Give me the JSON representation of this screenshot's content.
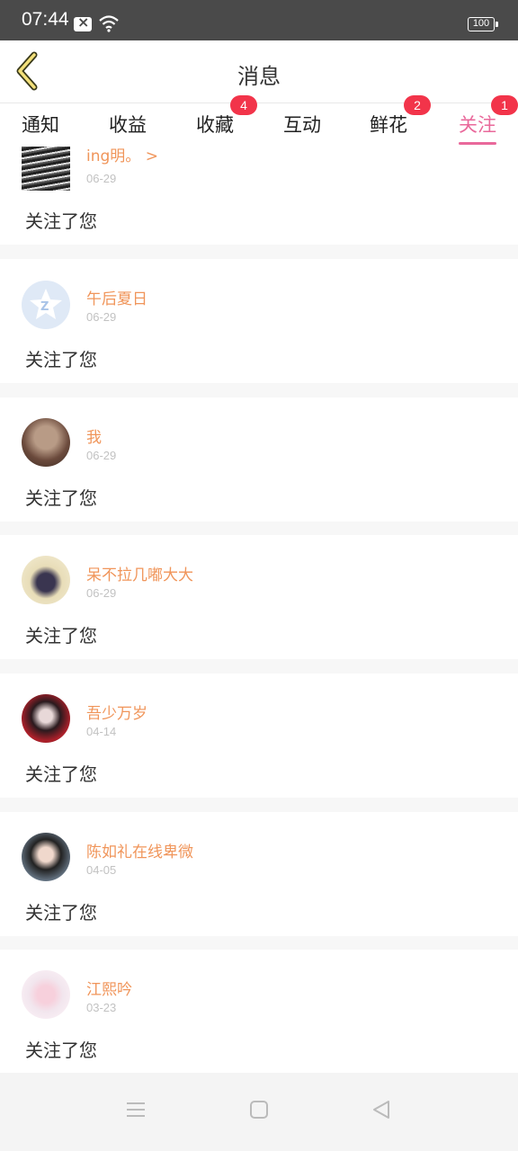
{
  "status_bar": {
    "time": "07:44",
    "battery": "100"
  },
  "header": {
    "title": "消息"
  },
  "tabs": [
    {
      "label": "通知",
      "badge": ""
    },
    {
      "label": "收益",
      "badge": ""
    },
    {
      "label": "收藏",
      "badge": "4"
    },
    {
      "label": "互动",
      "badge": ""
    },
    {
      "label": "鲜花",
      "badge": "2"
    },
    {
      "label": "关注",
      "badge": "1"
    }
  ],
  "active_tab": "关注",
  "colors": {
    "accent": "#e9699b",
    "name": "#f0955a",
    "badge": "#f2344a"
  },
  "items": [
    {
      "name": "ing明。 >",
      "date": "06-29",
      "text": "关注了您"
    },
    {
      "name": "午后夏日",
      "date": "06-29",
      "text": "关注了您"
    },
    {
      "name": "我",
      "date": "06-29",
      "text": "关注了您"
    },
    {
      "name": "呆不拉几嘟大大",
      "date": "06-29",
      "text": "关注了您"
    },
    {
      "name": "吾少万岁",
      "date": "04-14",
      "text": "关注了您"
    },
    {
      "name": "陈如礼在线卑微",
      "date": "04-05",
      "text": "关注了您"
    },
    {
      "name": "江熙吟",
      "date": "03-23",
      "text": "关注了您"
    }
  ]
}
